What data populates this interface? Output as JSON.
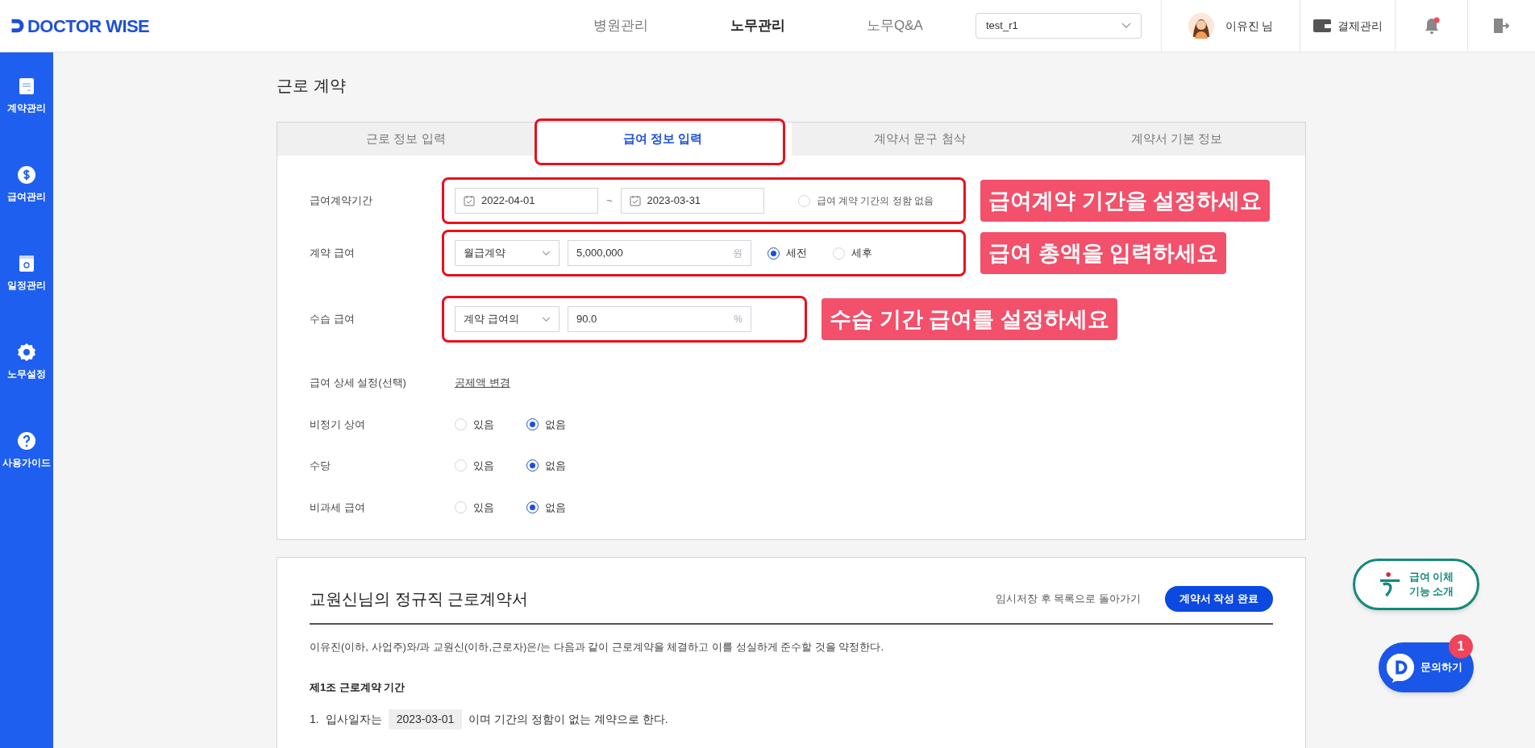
{
  "header": {
    "logo": "DOCTOR WISE",
    "nav": [
      {
        "label": "병원관리",
        "selected": false
      },
      {
        "label": "노무관리",
        "selected": true
      },
      {
        "label": "노무Q&A",
        "selected": false
      }
    ],
    "hospital_select": "test_r1",
    "user": "이유진 님",
    "billing": "결제관리",
    "notification": true
  },
  "sidebar": [
    {
      "label": "계약관리"
    },
    {
      "label": "급여관리"
    },
    {
      "label": "일정관리"
    },
    {
      "label": "노무설정"
    },
    {
      "label": "사용가이드"
    }
  ],
  "page_title": "근로 계약",
  "tabs": [
    {
      "label": "근로 정보 입력",
      "selected": false,
      "highlighted": false
    },
    {
      "label": "급여 정보 입력",
      "selected": true,
      "highlighted": true
    },
    {
      "label": "계약서 문구 첨삭",
      "selected": false,
      "highlighted": false
    },
    {
      "label": "계약서 기본 정보",
      "selected": false,
      "highlighted": false
    }
  ],
  "form_rows": [
    {
      "kind": "date_range",
      "label": "급여계약기간",
      "start": "2022-04-01",
      "separator": "~",
      "end": "2023-03-31",
      "option": {
        "label": "급여 계약 기간의 정함 없음",
        "checked": false
      },
      "highlighted": true,
      "callout": "급여계약 기간을 설정하세요"
    },
    {
      "kind": "amount",
      "label": "계약 급여",
      "type_select": "월급계약",
      "value": "5,000,000",
      "unit": "원",
      "options": [
        {
          "label": "세전",
          "selected": true
        },
        {
          "label": "세후",
          "selected": false
        }
      ],
      "highlighted": true,
      "callout": "급여 총액을 입력하세요"
    },
    {
      "kind": "ratio",
      "label": "수습 급여",
      "type_select": "계약 급여의",
      "value": "90.0",
      "unit": "%",
      "highlighted": true,
      "callout": "수습 기간 급여를 설정하세요"
    },
    {
      "kind": "link",
      "label": "급여 상세 설정(선택)",
      "link": "공제액 변경"
    },
    {
      "kind": "choice",
      "label": "비정기 상여",
      "options": [
        {
          "label": "있음",
          "selected": false
        },
        {
          "label": "없음",
          "selected": true
        }
      ]
    },
    {
      "kind": "choice",
      "label": "수당",
      "options": [
        {
          "label": "있음",
          "selected": false
        },
        {
          "label": "없음",
          "selected": true
        }
      ]
    },
    {
      "kind": "choice",
      "label": "비과세 급여",
      "options": [
        {
          "label": "있음",
          "selected": false
        },
        {
          "label": "없음",
          "selected": true
        }
      ]
    }
  ],
  "contract": {
    "title": "교원신님의 정규직 근로계약서",
    "save_link": "임시저장 후 목록으로 돌아가기",
    "complete_button": "계약서 작성 완료",
    "intro": "이유진(이하, 사업주)와/과 교원신(이하,근로자)은/는 다음과 같이 근로계약을 체결하고 이를 성실하게 준수할 것을 약정한다.",
    "article_title": "제1조 근로계약 기간",
    "clauses": [
      {
        "number": "1.",
        "parts": [
          {
            "kind": "text",
            "text": "입사일자는"
          },
          {
            "kind": "value",
            "text": "2023-03-01"
          },
          {
            "kind": "text",
            "text": "이며 기간의 정함이 없는 계약으로 한다."
          }
        ]
      }
    ]
  },
  "floating": {
    "transfer_button": [
      "급여 이체",
      "기능 소개"
    ],
    "inquiry_button": "문의하기",
    "inquiry_badge": "1"
  }
}
